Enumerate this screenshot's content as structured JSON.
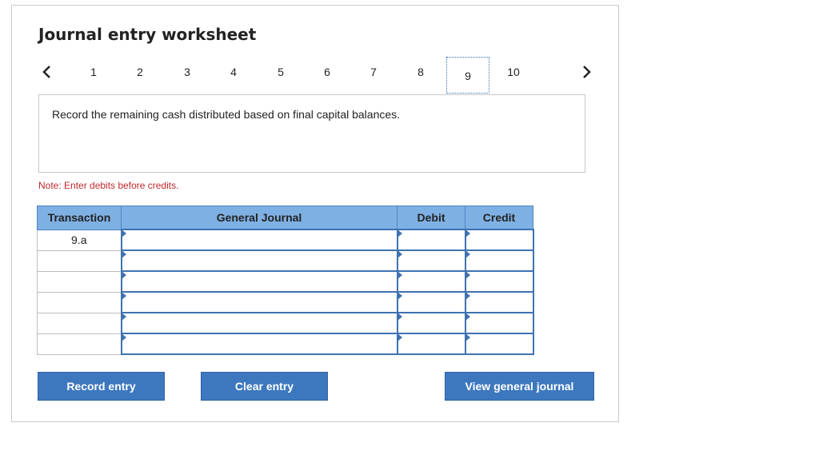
{
  "title": "Journal entry worksheet",
  "pagination": {
    "prev_icon": "chevron-left-icon",
    "next_icon": "chevron-right-icon",
    "pages": [
      "1",
      "2",
      "3",
      "4",
      "5",
      "6",
      "7",
      "8",
      "9",
      "10"
    ],
    "active_page": "9"
  },
  "prompt": "Record the remaining cash distributed based on final capital balances.",
  "note": "Note: Enter debits before credits.",
  "table": {
    "headers": {
      "transaction": "Transaction",
      "general_journal": "General Journal",
      "debit": "Debit",
      "credit": "Credit"
    },
    "rows": [
      {
        "transaction": "9.a",
        "account": "",
        "debit": "",
        "credit": ""
      },
      {
        "transaction": "",
        "account": "",
        "debit": "",
        "credit": ""
      },
      {
        "transaction": "",
        "account": "",
        "debit": "",
        "credit": ""
      },
      {
        "transaction": "",
        "account": "",
        "debit": "",
        "credit": ""
      },
      {
        "transaction": "",
        "account": "",
        "debit": "",
        "credit": ""
      },
      {
        "transaction": "",
        "account": "",
        "debit": "",
        "credit": ""
      }
    ]
  },
  "buttons": {
    "record": "Record entry",
    "clear": "Clear entry",
    "view": "View general journal"
  },
  "colors": {
    "header_bg": "#7fb0e3",
    "button_bg": "#3d78bf",
    "note_text": "#c0282d"
  }
}
